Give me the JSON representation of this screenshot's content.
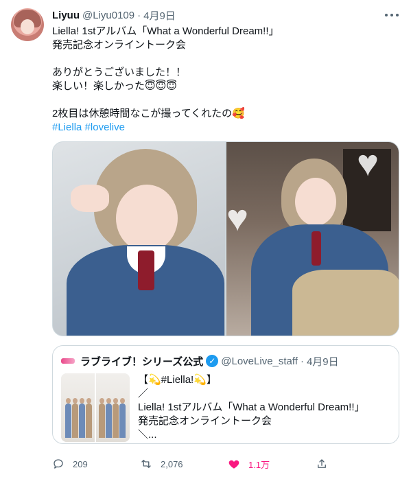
{
  "tweet": {
    "author_name": "Liyuu",
    "author_handle": "@Liyu0109",
    "dot": "·",
    "date": "4月9日",
    "text_lines": [
      "Liella! 1stアルバム「What a Wonderful Dream!!」",
      "発売記念オンライントーク会",
      "",
      "ありがとうございました！！",
      "楽しい！楽しかった😇😇😇",
      "",
      "2枚目は休憩時間なこが撮ってくれたの🥰"
    ],
    "hashtags": [
      "#Liella",
      "#lovelive"
    ]
  },
  "quoted": {
    "author_name": "ラブライブ！シリーズ公式",
    "verified_mark": "✓",
    "author_handle": "@LoveLive_staff",
    "dot": "·",
    "date": "4月9日",
    "text_lines": [
      "【💫#Liella!💫】",
      "／",
      "Liella! 1stアルバム「What a Wonderful Dream!!」",
      "発売記念オンライントーク会",
      "＼..."
    ]
  },
  "actions": {
    "reply_count": "209",
    "retweet_count": "2,076",
    "like_count": "1.1万"
  },
  "colors": {
    "link": "#1d9bf0",
    "muted": "#536471",
    "like": "#f91880",
    "border": "#cfd9de"
  }
}
